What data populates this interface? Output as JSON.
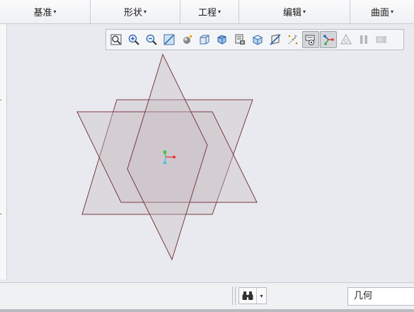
{
  "ribbon": {
    "groups": [
      {
        "label": "基准",
        "caret": "▾"
      },
      {
        "label": "形状",
        "caret": "▾"
      },
      {
        "label": "工程",
        "caret": "▾"
      },
      {
        "label": "编辑",
        "caret": "▾"
      },
      {
        "label": "曲面",
        "caret": "▾"
      }
    ]
  },
  "view_toolbar": {
    "buttons": [
      {
        "icon": "refit-icon"
      },
      {
        "icon": "zoom-in-icon"
      },
      {
        "icon": "zoom-out-icon"
      },
      {
        "icon": "repaint-icon"
      },
      {
        "icon": "perspective-view-icon"
      },
      {
        "icon": "display-style-icon"
      },
      {
        "icon": "saved-orientations-icon"
      },
      {
        "icon": "view-manager-icon"
      },
      {
        "icon": "appearance-icon"
      },
      {
        "icon": "section-icon"
      },
      {
        "icon": "datum-display-filters-icon"
      },
      {
        "icon": "annotation-display-icon"
      },
      {
        "icon": "spin-center-icon"
      },
      {
        "icon": "notification-center-icon"
      },
      {
        "icon": "pause-icon"
      },
      {
        "icon": "animation-icon"
      }
    ]
  },
  "status_bar": {
    "find_icon": "binoculars-icon",
    "filter_value": "几何"
  },
  "colors": {
    "plane_edge": "#7a3b41",
    "plane_fill": "#c8bdc3",
    "csys_x": "#e53935",
    "csys_y": "#43c04a",
    "csys_z": "#3fc7d8"
  }
}
